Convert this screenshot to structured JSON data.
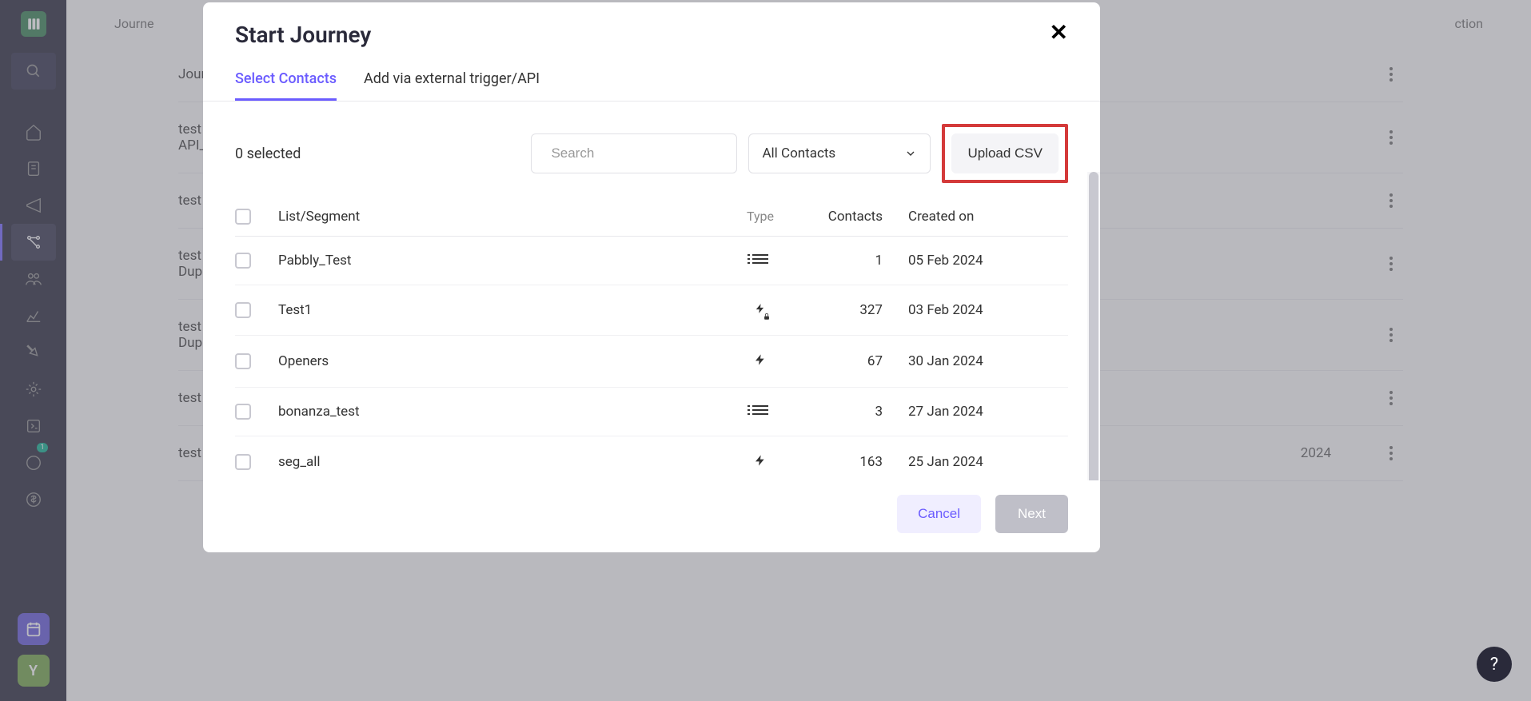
{
  "sidebar": {
    "badge": "1",
    "bottom_letter": "Y"
  },
  "background": {
    "header_left": "Journe",
    "header_right": "ction",
    "rows": [
      {
        "text": "Journe",
        "date": ""
      },
      {
        "text": "test co\nAPI_al",
        "date": ""
      },
      {
        "text": "test co",
        "date": ""
      },
      {
        "text": "test co\nDuplic",
        "date": ""
      },
      {
        "text": "test co\nDuplic",
        "date": ""
      },
      {
        "text": "test co",
        "date": ""
      },
      {
        "text": "test co",
        "date": "2024"
      }
    ]
  },
  "modal": {
    "title": "Start Journey",
    "tabs": {
      "select_contacts": "Select Contacts",
      "external_trigger": "Add via external trigger/API"
    },
    "selected_count": "0 selected",
    "search_placeholder": "Search",
    "filter_label": "All Contacts",
    "upload_csv": "Upload CSV",
    "table_headers": {
      "list_segment": "List/Segment",
      "type": "Type",
      "contacts": "Contacts",
      "created_on": "Created on"
    },
    "rows": [
      {
        "name": "Pabbly_Test",
        "type": "list",
        "contacts": "1",
        "created": "05 Feb 2024"
      },
      {
        "name": "Test1",
        "type": "bolt-lock",
        "contacts": "327",
        "created": "03 Feb 2024"
      },
      {
        "name": "Openers",
        "type": "bolt",
        "contacts": "67",
        "created": "30 Jan 2024"
      },
      {
        "name": "bonanza_test",
        "type": "list",
        "contacts": "3",
        "created": "27 Jan 2024"
      },
      {
        "name": "seg_all",
        "type": "bolt",
        "contacts": "163",
        "created": "25 Jan 2024"
      }
    ],
    "cancel": "Cancel",
    "next": "Next"
  },
  "help": "?"
}
